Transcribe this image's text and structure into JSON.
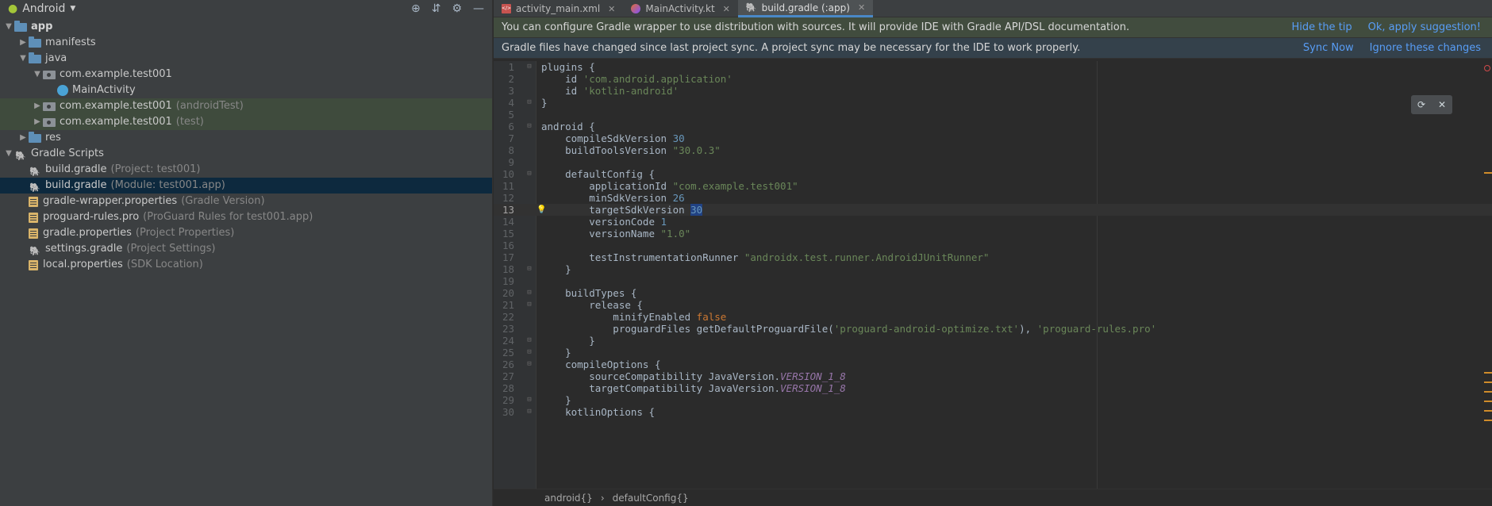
{
  "project": {
    "view_label": "Android",
    "tree": [
      {
        "label": "app",
        "depth": 0,
        "arrow": "down",
        "icon": "folder",
        "bold": true
      },
      {
        "label": "manifests",
        "depth": 1,
        "arrow": "right",
        "icon": "folder"
      },
      {
        "label": "java",
        "depth": 1,
        "arrow": "down",
        "icon": "folder"
      },
      {
        "label": "com.example.test001",
        "depth": 2,
        "arrow": "down",
        "icon": "pkg"
      },
      {
        "label": "MainActivity",
        "depth": 3,
        "arrow": "",
        "icon": "klass"
      },
      {
        "label": "com.example.test001",
        "suffix": "(androidTest)",
        "depth": 2,
        "arrow": "right",
        "icon": "pkg",
        "hl": true
      },
      {
        "label": "com.example.test001",
        "suffix": "(test)",
        "depth": 2,
        "arrow": "right",
        "icon": "pkg",
        "hl": true
      },
      {
        "label": "res",
        "depth": 1,
        "arrow": "right",
        "icon": "folder"
      },
      {
        "label": "Gradle Scripts",
        "depth": 0,
        "arrow": "down",
        "icon": "gradle"
      },
      {
        "label": "build.gradle",
        "suffix": "(Project: test001)",
        "depth": 1,
        "arrow": "",
        "icon": "gradle"
      },
      {
        "label": "build.gradle",
        "suffix": "(Module: test001.app)",
        "depth": 1,
        "arrow": "",
        "icon": "gradle",
        "sel": true
      },
      {
        "label": "gradle-wrapper.properties",
        "suffix": "(Gradle Version)",
        "depth": 1,
        "arrow": "",
        "icon": "prop"
      },
      {
        "label": "proguard-rules.pro",
        "suffix": "(ProGuard Rules for test001.app)",
        "depth": 1,
        "arrow": "",
        "icon": "prop"
      },
      {
        "label": "gradle.properties",
        "suffix": "(Project Properties)",
        "depth": 1,
        "arrow": "",
        "icon": "prop"
      },
      {
        "label": "settings.gradle",
        "suffix": "(Project Settings)",
        "depth": 1,
        "arrow": "",
        "icon": "gradle"
      },
      {
        "label": "local.properties",
        "suffix": "(SDK Location)",
        "depth": 1,
        "arrow": "",
        "icon": "prop"
      }
    ]
  },
  "tabs": [
    {
      "label": "activity_main.xml",
      "icon": "xml"
    },
    {
      "label": "MainActivity.kt",
      "icon": "kt"
    },
    {
      "label": "build.gradle (:app)",
      "icon": "gradle",
      "active": true
    }
  ],
  "banners": {
    "tip": {
      "text": "You can configure Gradle wrapper to use distribution with sources. It will provide IDE with Gradle API/DSL documentation.",
      "link1": "Hide the tip",
      "link2": "Ok, apply suggestion!"
    },
    "sync": {
      "text": "Gradle files have changed since last project sync. A project sync may be necessary for the IDE to work properly.",
      "link1": "Sync Now",
      "link2": "Ignore these changes"
    }
  },
  "editor": {
    "current_line": 13,
    "lines": [
      [
        [
          "plugins {",
          ""
        ]
      ],
      [
        [
          "    id ",
          ""
        ],
        [
          "'com.android.application'",
          "str"
        ]
      ],
      [
        [
          "    id ",
          ""
        ],
        [
          "'kotlin-android'",
          "str"
        ]
      ],
      [
        [
          "}",
          ""
        ]
      ],
      [
        [
          "",
          ""
        ]
      ],
      [
        [
          "android {",
          ""
        ]
      ],
      [
        [
          "    compileSdkVersion ",
          ""
        ],
        [
          "30",
          "num"
        ]
      ],
      [
        [
          "    buildToolsVersion ",
          ""
        ],
        [
          "\"30.0.3\"",
          "str"
        ]
      ],
      [
        [
          "",
          ""
        ]
      ],
      [
        [
          "    defaultConfig {",
          ""
        ]
      ],
      [
        [
          "        applicationId ",
          ""
        ],
        [
          "\"com.example.test001\"",
          "str"
        ]
      ],
      [
        [
          "        minSdkVersion ",
          ""
        ],
        [
          "26",
          "num"
        ]
      ],
      [
        [
          "        targetSdkVersion ",
          ""
        ],
        [
          "30",
          "num caret"
        ]
      ],
      [
        [
          "        versionCode ",
          ""
        ],
        [
          "1",
          "num"
        ]
      ],
      [
        [
          "        versionName ",
          ""
        ],
        [
          "\"1.0\"",
          "str"
        ]
      ],
      [
        [
          "",
          ""
        ]
      ],
      [
        [
          "        testInstrumentationRunner ",
          ""
        ],
        [
          "\"androidx.test.runner.AndroidJUnitRunner\"",
          "str"
        ]
      ],
      [
        [
          "    }",
          ""
        ]
      ],
      [
        [
          "",
          ""
        ]
      ],
      [
        [
          "    buildTypes {",
          ""
        ]
      ],
      [
        [
          "        release {",
          ""
        ]
      ],
      [
        [
          "            minifyEnabled ",
          ""
        ],
        [
          "false",
          "kw"
        ]
      ],
      [
        [
          "            proguardFiles getDefaultProguardFile(",
          ""
        ],
        [
          "'proguard-android-optimize.txt'",
          "str"
        ],
        [
          "), ",
          ""
        ],
        [
          "'proguard-rules.pro'",
          "str"
        ]
      ],
      [
        [
          "        }",
          ""
        ]
      ],
      [
        [
          "    }",
          ""
        ]
      ],
      [
        [
          "    compileOptions {",
          ""
        ]
      ],
      [
        [
          "        sourceCompatibility JavaVersion.",
          ""
        ],
        [
          "VERSION_1_8",
          "ital"
        ]
      ],
      [
        [
          "        targetCompatibility JavaVersion.",
          ""
        ],
        [
          "VERSION_1_8",
          "ital"
        ]
      ],
      [
        [
          "    }",
          ""
        ]
      ],
      [
        [
          "    kotlinOptions {",
          ""
        ]
      ]
    ],
    "fold_lines": [
      1,
      4,
      6,
      10,
      18,
      20,
      21,
      24,
      25,
      26,
      29,
      30
    ]
  },
  "breadcrumb": [
    "android{}",
    "defaultConfig{}"
  ],
  "colors": {
    "accent": "#4a88c7",
    "link": "#589df6"
  }
}
